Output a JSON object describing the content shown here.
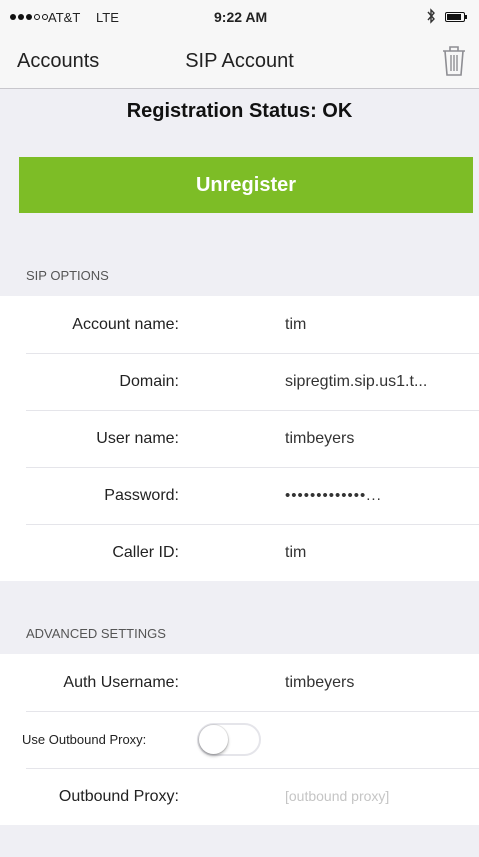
{
  "status_bar": {
    "carrier": "AT&T",
    "network": "LTE",
    "time": "9:22 AM",
    "battery_level": 0.9,
    "signal_bars_filled": 3,
    "signal_bars_total": 5
  },
  "nav": {
    "back_label": "Accounts",
    "title": "SIP Account",
    "trash_icon": "trash-icon"
  },
  "registration": {
    "status_text": "Registration Status: OK",
    "button_label": "Unregister",
    "button_color": "#7dbd26"
  },
  "sip_options": {
    "header": "SIP OPTIONS",
    "rows": [
      {
        "label": "Account name:",
        "value": "tim"
      },
      {
        "label": "Domain:",
        "value": "sipregtim.sip.us1.t..."
      },
      {
        "label": "User name:",
        "value": "timbeyers"
      },
      {
        "label": "Password:",
        "value": "•••••••••••••..."
      },
      {
        "label": "Caller ID:",
        "value": "tim"
      }
    ]
  },
  "advanced": {
    "header": "ADVANCED SETTINGS",
    "auth_username_label": "Auth Username:",
    "auth_username_value": "timbeyers",
    "use_outbound_proxy_label": "Use Outbound Proxy:",
    "use_outbound_proxy_on": false,
    "outbound_proxy_label": "Outbound Proxy:",
    "outbound_proxy_placeholder": "[outbound proxy]"
  }
}
